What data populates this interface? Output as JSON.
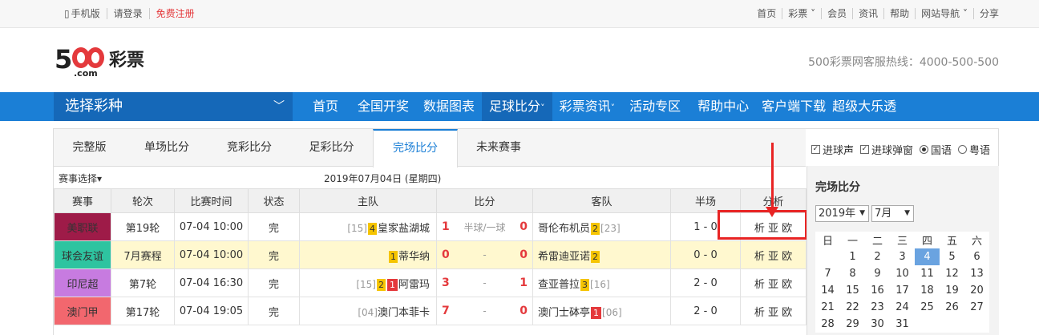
{
  "topbar": {
    "left": [
      "手机版",
      "请登录",
      "免费注册"
    ],
    "right": [
      "首页",
      "彩票",
      "会员",
      "资讯",
      "帮助",
      "网站导航",
      "分享"
    ]
  },
  "header": {
    "logo_text": "500彩票",
    "logo_sub": ".com",
    "hotline": "500彩票网客服热线：4000-500-500"
  },
  "nav": {
    "select_label": "选择彩种",
    "items": [
      "首页",
      "全国开奖",
      "数据图表",
      "足球比分",
      "彩票资讯",
      "活动专区",
      "帮助中心",
      "客户端下载",
      "超级大乐透"
    ]
  },
  "tabs": [
    "完整版",
    "单场比分",
    "竞彩比分",
    "足彩比分",
    "完场比分",
    "未来赛事"
  ],
  "options": [
    "进球声",
    "进球弹窗",
    "国语",
    "粤语"
  ],
  "filter": {
    "label": "赛事选择",
    "date": "2019年07月04日 (星期四)"
  },
  "table": {
    "headers": [
      "赛事",
      "轮次",
      "比赛时间",
      "状态",
      "主队",
      "比分",
      "客队",
      "半场",
      "分析"
    ],
    "rows": [
      {
        "league": "美职联",
        "color": "#9e1b48",
        "round": "第19轮",
        "time": "07-04 10:00",
        "status": "完",
        "home_rank": "[15]",
        "home_yellow": "4",
        "home_red": "",
        "home": "皇家盐湖城",
        "hg": "1",
        "handicap": "半球/一球",
        "ag": "0",
        "away": "哥伦布机员",
        "away_yellow": "2",
        "away_red": "",
        "away_rank": "[23]",
        "half": "1 - 0",
        "analysis": "析 亚 欧"
      },
      {
        "league": "球会友谊",
        "color": "#2ec4a0",
        "round": "7月赛程",
        "time": "07-04 10:00",
        "status": "完",
        "home_rank": "",
        "home_yellow": "1",
        "home_red": "",
        "home": "蒂华纳",
        "hg": "0",
        "handicap": "-",
        "ag": "0",
        "away": "希雷迪亚诺",
        "away_yellow": "2",
        "away_red": "",
        "away_rank": "",
        "half": "0 - 0",
        "analysis": "析 亚 欧"
      },
      {
        "league": "印尼超",
        "color": "#c77be0",
        "round": "第7轮",
        "time": "07-04 16:30",
        "status": "完",
        "home_rank": "[15]",
        "home_yellow": "2",
        "home_red": "1",
        "home": "阿雷玛",
        "hg": "3",
        "handicap": "-",
        "ag": "1",
        "away": "查亚普拉",
        "away_yellow": "3",
        "away_red": "",
        "away_rank": "[16]",
        "half": "2 - 0",
        "analysis": "析 亚 欧"
      },
      {
        "league": "澳门甲",
        "color": "#f2676e",
        "round": "第17轮",
        "time": "07-04 19:05",
        "status": "完",
        "home_rank": "[04]",
        "home_yellow": "",
        "home_red": "",
        "home": "澳门本菲卡",
        "hg": "7",
        "handicap": "-",
        "ag": "0",
        "away": "澳门士砵亭",
        "away_yellow": "",
        "away_red": "1",
        "away_rank": "[06]",
        "half": "2 - 0",
        "analysis": "析 亚 欧"
      }
    ]
  },
  "sidebar": {
    "title": "完场比分",
    "year": "2019年",
    "month": "7月",
    "weekdays": [
      "日",
      "一",
      "二",
      "三",
      "四",
      "五",
      "六"
    ],
    "weeks": [
      [
        "",
        "1",
        "2",
        "3",
        "4",
        "5",
        "6"
      ],
      [
        "7",
        "8",
        "9",
        "10",
        "11",
        "12",
        "13"
      ],
      [
        "14",
        "15",
        "16",
        "17",
        "18",
        "19",
        "20"
      ],
      [
        "21",
        "22",
        "23",
        "24",
        "25",
        "26",
        "27"
      ],
      [
        "28",
        "29",
        "30",
        "31",
        "",
        "",
        ""
      ]
    ],
    "today": "4"
  }
}
